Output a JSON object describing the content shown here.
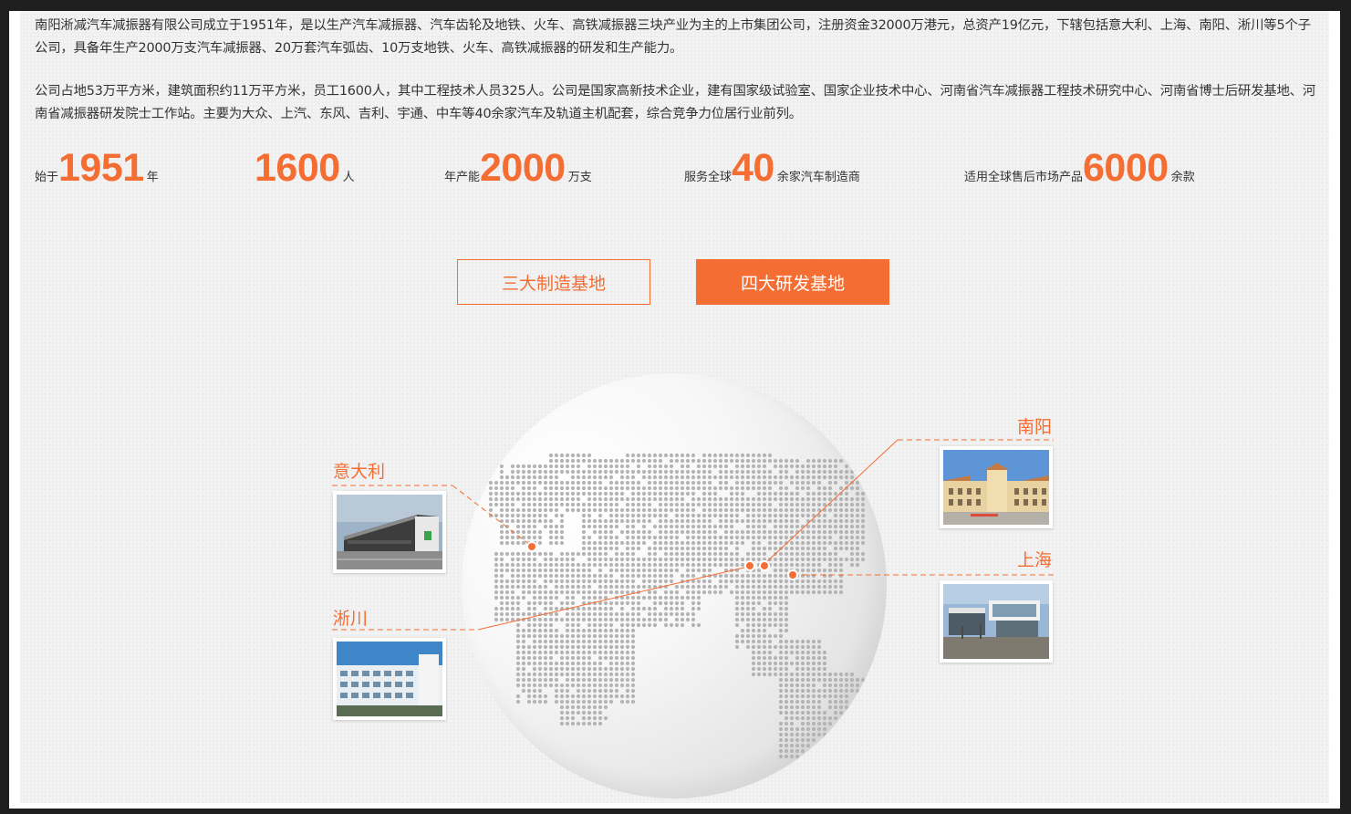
{
  "intro": {
    "paragraph1": "南阳淅减汽车减振器有限公司成立于1951年，是以生产汽车减振器、汽车齿轮及地铁、火车、高铁减振器三块产业为主的上市集团公司，注册资金32000万港元，总资产19亿元，下辖包括意大利、上海、南阳、淅川等5个子公司，具备年生产2000万支汽车减振器、20万套汽车弧齿、10万支地铁、火车、高铁减振器的研发和生产能力。",
    "paragraph2": "公司占地53万平方米，建筑面积约11万平方米，员工1600人，其中工程技术人员325人。公司是国家高新技术企业，建有国家级试验室、国家企业技术中心、河南省汽车减振器工程技术研究中心、河南省博士后研发基地、河南省减振器研发院士工作站。主要为大众、上汽、东风、吉利、宇通、中车等40余家汽车及轨道主机配套，综合竞争力位居行业前列。"
  },
  "stats": [
    {
      "prefix": "始于",
      "number": "1951",
      "suffix": "年"
    },
    {
      "prefix": "",
      "number": "1600",
      "suffix": "人"
    },
    {
      "prefix": "年产能",
      "number": "2000",
      "suffix": "万支"
    },
    {
      "prefix": "服务全球",
      "number": "40",
      "suffix": "余家汽车制造商"
    },
    {
      "prefix": "适用全球售后市场产品",
      "number": "6000",
      "suffix": "余款"
    }
  ],
  "tabs": {
    "manufacturing": "三大制造基地",
    "rnd": "四大研发基地"
  },
  "locations": {
    "italy": "意大利",
    "xichuan": "淅川",
    "nanyang": "南阳",
    "shanghai": "上海"
  },
  "colors": {
    "accent": "#f46d32",
    "text": "#333333",
    "panel": "#efefef",
    "dot": "#b4b4b4"
  }
}
